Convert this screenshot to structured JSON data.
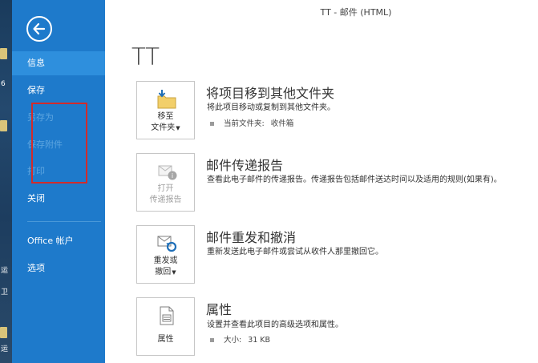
{
  "window_title": "TT - 邮件 (HTML)",
  "page_title": "TT",
  "desktop_strip": {
    "texts": [
      "6",
      "运",
      "卫",
      "运"
    ]
  },
  "sidebar": {
    "items": [
      {
        "label": "信息"
      },
      {
        "label": "保存"
      },
      {
        "label": "另存为"
      },
      {
        "label": "保存附件"
      },
      {
        "label": "打印"
      },
      {
        "label": "关闭"
      },
      {
        "label": "Office 帐户"
      },
      {
        "label": "选项"
      }
    ]
  },
  "sections": {
    "move": {
      "tile_line1": "移至",
      "tile_line2": "文件夹",
      "title": "将项目移到其他文件夹",
      "desc": "将此项目移动或复制到其他文件夹。",
      "bullet_label": "当前文件夹:",
      "bullet_value": "收件箱"
    },
    "receipt": {
      "tile_line1": "打开",
      "tile_line2": "传递报告",
      "title": "邮件传递报告",
      "desc": "查看此电子邮件的传递报告。传递报告包括邮件送达时间以及适用的规则(如果有)。"
    },
    "resend": {
      "tile_line1": "重发或",
      "tile_line2": "撤回",
      "title": "邮件重发和撤消",
      "desc": "重新发送此电子邮件或尝试从收件人那里撤回它。"
    },
    "properties": {
      "tile_line1": "属性",
      "title": "属性",
      "desc": "设置并查看此项目的高级选项和属性。",
      "bullet_label": "大小:",
      "bullet_value": "31 KB"
    }
  }
}
